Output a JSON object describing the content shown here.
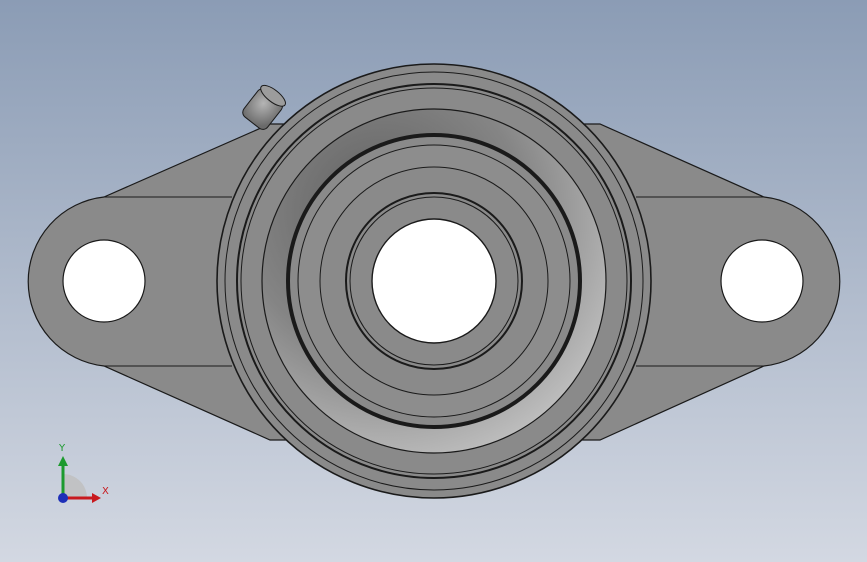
{
  "viewport": {
    "background_top": "#8b9cb5",
    "background_bottom": "#d3d8e2"
  },
  "model": {
    "body_color": "#8a8a8a",
    "edge_color": "#1a1a1a",
    "hole_color": "#ffffff"
  },
  "triad": {
    "x_label": "X",
    "y_label": "Y",
    "x_color": "#c8191e",
    "y_color": "#1c9a2e",
    "z_color": "#1d2fb8"
  }
}
